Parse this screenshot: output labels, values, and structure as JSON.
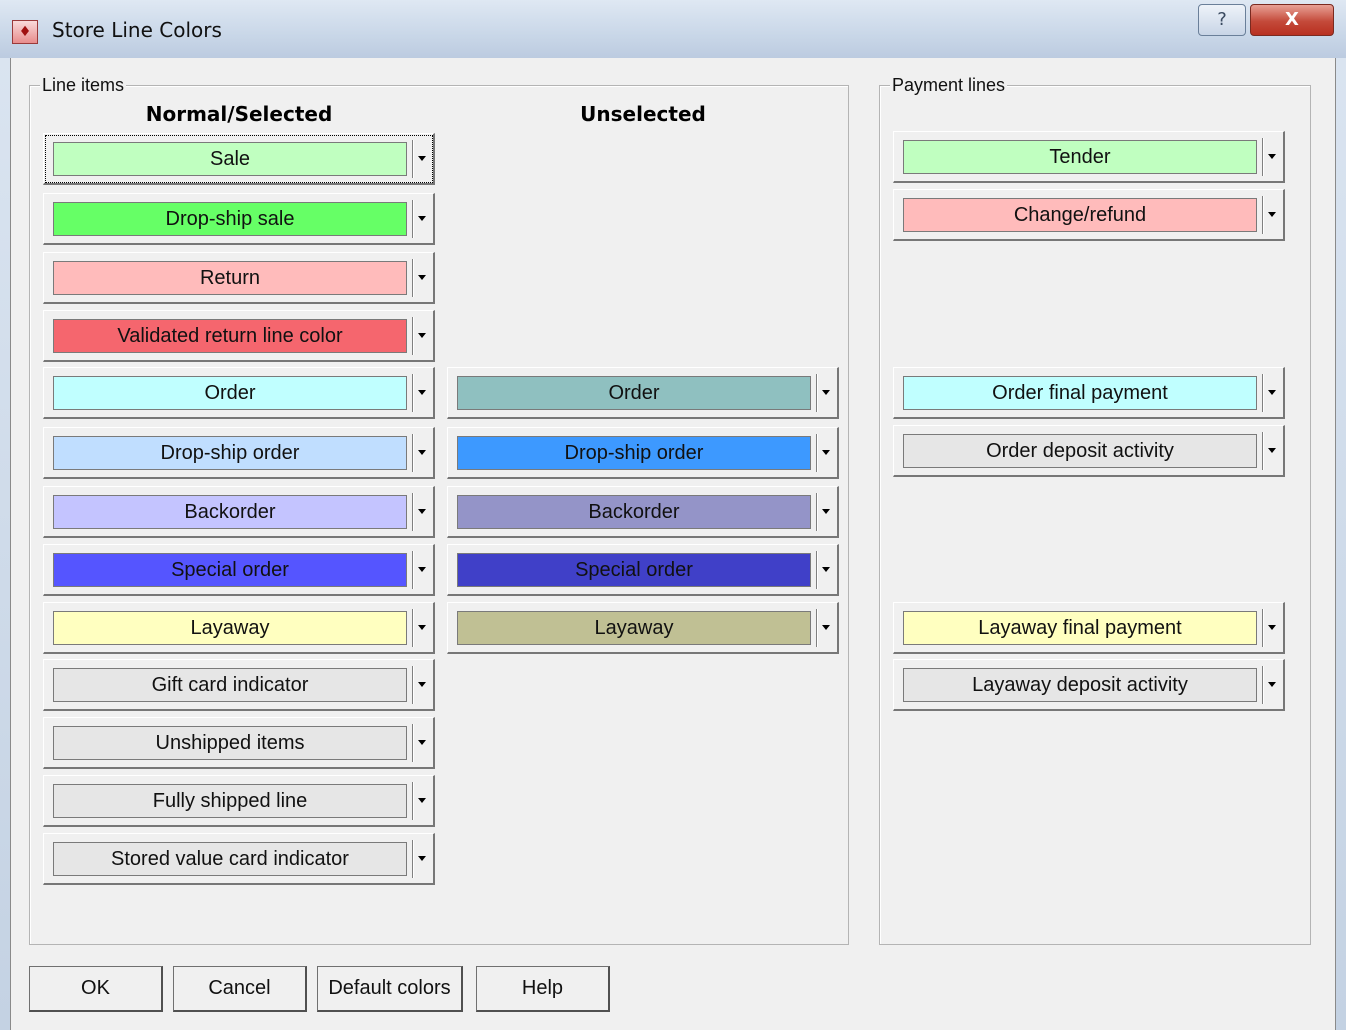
{
  "window": {
    "title": "Store Line Colors",
    "help_glyph": "?",
    "close_glyph": "X",
    "icon": "app-icon"
  },
  "line_items": {
    "legend": "Line items",
    "normal_header": "Normal/Selected",
    "unselected_header": "Unselected",
    "normal": [
      {
        "label": "Sale",
        "color": "#c0ffc0"
      },
      {
        "label": "Drop-ship sale",
        "color": "#66ff66"
      },
      {
        "label": "Return",
        "color": "#ffbbbb"
      },
      {
        "label": "Validated return line color",
        "color": "#f5666e"
      },
      {
        "label": "Order",
        "color": "#c0ffff"
      },
      {
        "label": "Drop-ship order",
        "color": "#c0deff"
      },
      {
        "label": "Backorder",
        "color": "#c4c4ff"
      },
      {
        "label": "Special order",
        "color": "#5555ff"
      },
      {
        "label": "Layaway",
        "color": "#ffffc0"
      },
      {
        "label": "Gift card indicator",
        "color": "#e6e6e6"
      },
      {
        "label": "Unshipped items",
        "color": "#e6e6e6"
      },
      {
        "label": "Fully shipped line",
        "color": "#e6e6e6"
      },
      {
        "label": "Stored value card indicator",
        "color": "#e6e6e6"
      }
    ],
    "unselected": [
      {
        "label": "Order",
        "color": "#8fc0c0"
      },
      {
        "label": "Drop-ship order",
        "color": "#3d99ff"
      },
      {
        "label": "Backorder",
        "color": "#9494c8"
      },
      {
        "label": "Special order",
        "color": "#4040c8"
      },
      {
        "label": "Layaway",
        "color": "#c0c094"
      }
    ]
  },
  "payment_lines": {
    "legend": "Payment lines",
    "items": [
      {
        "label": "Tender",
        "color": "#c0ffc0"
      },
      {
        "label": "Change/refund",
        "color": "#ffbbbb"
      },
      {
        "label": "Order final payment",
        "color": "#c0ffff"
      },
      {
        "label": "Order deposit activity",
        "color": "#e6e6e6"
      },
      {
        "label": "Layaway final payment",
        "color": "#ffffc0"
      },
      {
        "label": "Layaway deposit activity",
        "color": "#e6e6e6"
      }
    ]
  },
  "buttons": {
    "ok": "OK",
    "cancel": "Cancel",
    "default_colors": "Default colors",
    "help": "Help"
  }
}
